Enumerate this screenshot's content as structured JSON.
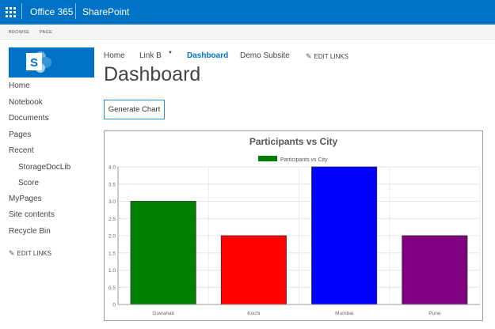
{
  "suite_bar": {
    "apps": [
      "Office 365",
      "SharePoint"
    ],
    "color": "#0072c6"
  },
  "ribbon": {
    "tabs": [
      "BROWSE",
      "PAGE"
    ]
  },
  "logo": {
    "letter": "S",
    "icon": "sharepoint-logo"
  },
  "quick_launch": {
    "items": [
      {
        "label": "Home",
        "level": 0
      },
      {
        "label": "Notebook",
        "level": 0
      },
      {
        "label": "Documents",
        "level": 0
      },
      {
        "label": "Pages",
        "level": 0
      },
      {
        "label": "Recent",
        "level": 0
      },
      {
        "label": "StorageDocLib",
        "level": 1
      },
      {
        "label": "Score",
        "level": 1
      },
      {
        "label": "MyPages",
        "level": 0
      },
      {
        "label": "Site contents",
        "level": 0
      },
      {
        "label": "Recycle Bin",
        "level": 0
      }
    ],
    "edit_links": "EDIT LINKS"
  },
  "top_nav": {
    "items": [
      {
        "label": "Home"
      },
      {
        "label": "Link B",
        "dropdown": true
      },
      {
        "label": "Dashboard",
        "active": true
      },
      {
        "label": "Demo Subsite"
      }
    ],
    "edit_links": "EDIT LINKS"
  },
  "page_title": "Dashboard",
  "generate_button": "Generate Chart",
  "chart_data": {
    "type": "bar",
    "title": "Participants vs City",
    "categories": [
      "Guwahati",
      "Kochi",
      "Mumbai",
      "Pune"
    ],
    "series": [
      {
        "name": "Participants vs City",
        "values": [
          3,
          2,
          4,
          2
        ]
      }
    ],
    "bar_colors": [
      "#008000",
      "#ff0000",
      "#0000ff",
      "#800080"
    ],
    "legend_color": "#008000",
    "legend_position": "top",
    "ylim": [
      0,
      4
    ],
    "yticks": [
      "0",
      "0.5",
      "1.0",
      "1.5",
      "2.0",
      "2.5",
      "3.0",
      "3.5",
      "4.0"
    ],
    "grid": true
  }
}
